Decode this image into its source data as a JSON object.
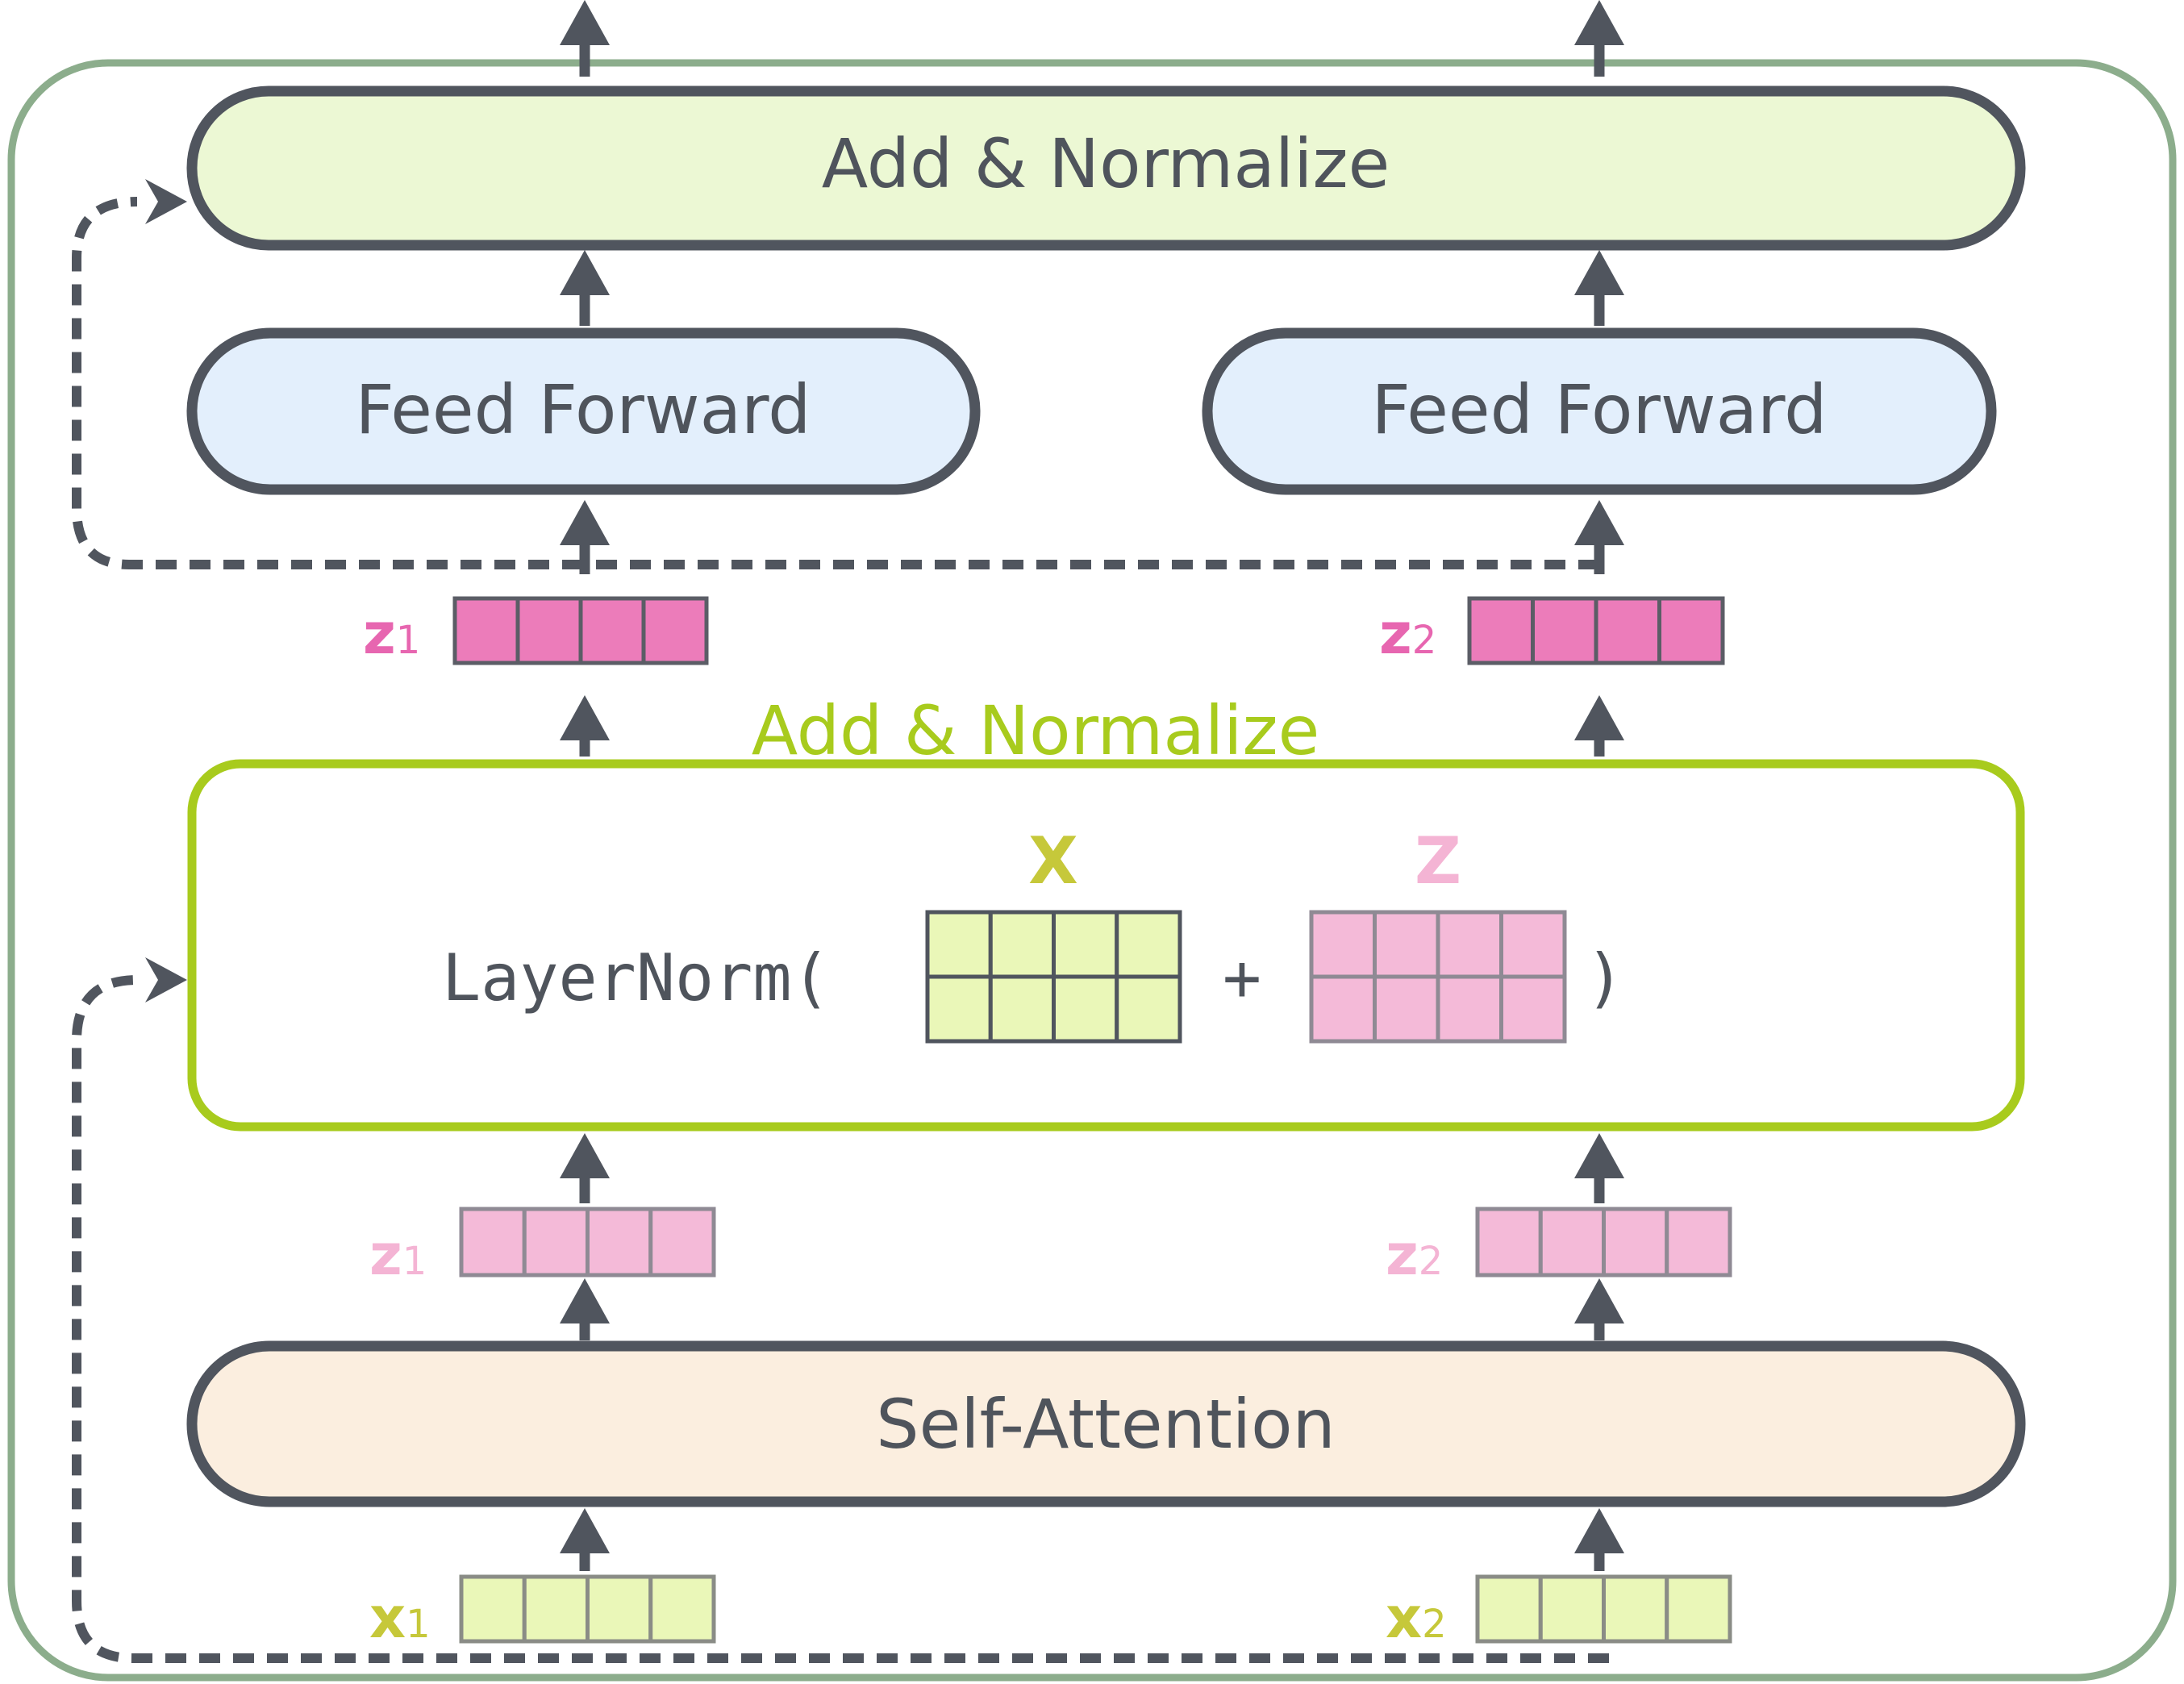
{
  "colors": {
    "outer_border": "#8cad8c",
    "dark": "#50555e",
    "add_norm_fill": "#ecf8d4",
    "feed_forward_fill": "#e3effc",
    "self_attention_fill": "#fbeedf",
    "layernorm_border": "#a8cb1d",
    "x_color": "#c6c83a",
    "x_cell_fill": "#eaf7b8",
    "z_dark_fill": "#ec7cba",
    "z_dark_text": "#e766b0",
    "z_light_fill": "#f4bad8",
    "z_light_text": "#f4b4d4"
  },
  "blocks": {
    "top_add_normalize": "Add & Normalize",
    "feed_forward_1": "Feed Forward",
    "feed_forward_2": "Feed Forward",
    "self_attention": "Self-Attention"
  },
  "layernorm": {
    "caption": "Add & Normalize",
    "func_open": "LayerNorm(",
    "plus": "+",
    "close": ")",
    "matrix_x_label": "X",
    "matrix_z_label": "Z"
  },
  "vectors": {
    "z1_top": {
      "base": "z",
      "sub": "1"
    },
    "z2_top": {
      "base": "z",
      "sub": "2"
    },
    "z1_mid": {
      "base": "z",
      "sub": "1"
    },
    "z2_mid": {
      "base": "z",
      "sub": "2"
    },
    "x1": {
      "base": "x",
      "sub": "1"
    },
    "x2": {
      "base": "x",
      "sub": "2"
    }
  }
}
